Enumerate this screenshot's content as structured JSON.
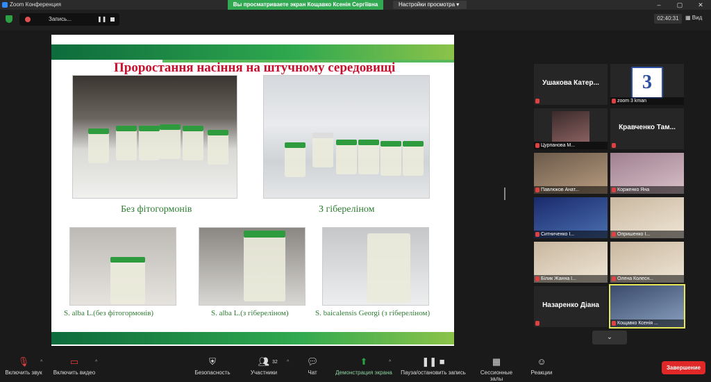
{
  "window": {
    "app_title": "Zoom Конференция",
    "share_banner": "Вы просматриваете экран Кощавко Ксенія Сергіївна",
    "view_options": "Настройки просмотра ▾",
    "controls": [
      "–",
      "▢",
      "✕"
    ]
  },
  "topbar": {
    "record_label": "Запись...",
    "record_pause": "❚❚",
    "timer": "02:40:31",
    "view_label": "Вид"
  },
  "slide": {
    "title": "Проростання насіння на штучному середовищі",
    "captions": [
      "Без фітогормонів",
      "З гібереліном",
      "S. alba L.(без фітогормонів)",
      "S. alba L.(з гібереліном)",
      "S. baicalensis Georgi  (з гібереліном)"
    ]
  },
  "participants": [
    {
      "name": "Ушакова Катер...",
      "big": "Ушакова  Катер...",
      "style": "text"
    },
    {
      "name": "zoom 3 kman",
      "style": "logo",
      "logo_text": "3"
    },
    {
      "name": "Цурпанова М...",
      "style": "avatar"
    },
    {
      "name": "",
      "big": "Кравченко  Там...",
      "style": "text"
    },
    {
      "name": "Павлюков Анат...",
      "style": "video"
    },
    {
      "name": "Корженко Яна",
      "style": "pink"
    },
    {
      "name": "Ситниченко І...",
      "style": "blue"
    },
    {
      "name": "Опришенко І...",
      "style": "light"
    },
    {
      "name": "Білик Жанна І...",
      "style": "light"
    },
    {
      "name": "Олена Колесн...",
      "style": "light"
    },
    {
      "name": "",
      "big": "Назаренко  Діана",
      "style": "text"
    },
    {
      "name": "Кощавко Ксенія ...",
      "style": "self"
    }
  ],
  "toolbar": {
    "audio": "Включить звук",
    "video": "Включить видео",
    "security": "Безопасность",
    "participants": "Участники",
    "participants_count": "32",
    "chat": "Чат",
    "share": "Демонстрация экрана",
    "record": "Пауза/остановить запись",
    "breakout": "Сессионные залы",
    "reactions": "Реакции",
    "end": "Завершение"
  },
  "colors": {
    "share_green": "#33a852",
    "end_red": "#e02828",
    "title_red": "#c8102e",
    "caption_green": "#2e7d32"
  }
}
